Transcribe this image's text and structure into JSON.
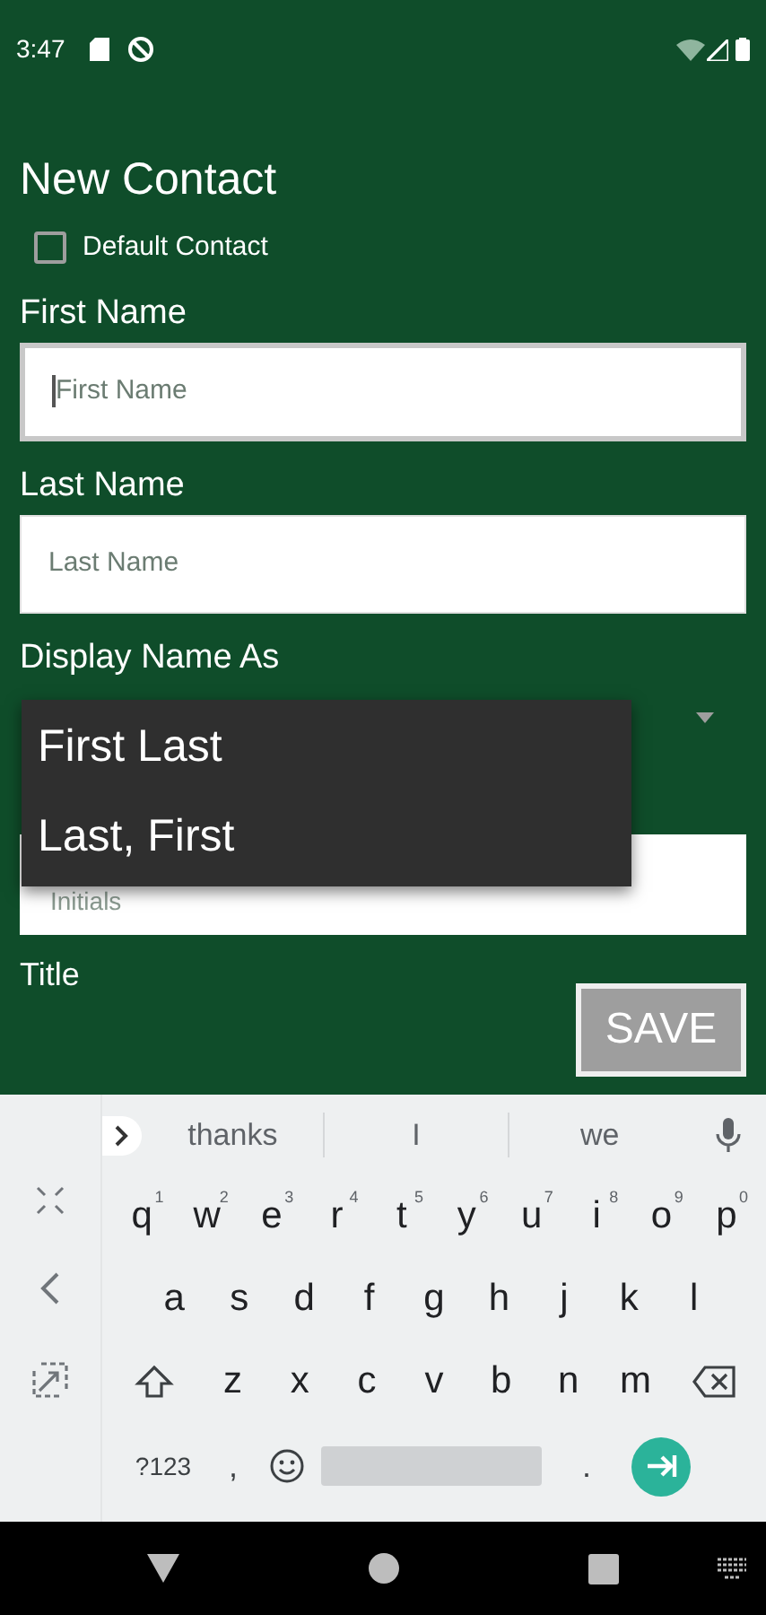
{
  "status_bar": {
    "time": "3:47"
  },
  "form": {
    "title": "New Contact",
    "default_contact": {
      "label": "Default Contact",
      "checked": false
    },
    "fields": [
      {
        "label": "First Name",
        "placeholder": "First Name",
        "focused": true
      },
      {
        "label": "Last Name",
        "placeholder": "Last Name",
        "focused": false
      }
    ],
    "display_name": {
      "label": "Display Name As",
      "options": [
        "First Last",
        "Last, First"
      ]
    },
    "initials": {
      "placeholder": "Initials"
    },
    "next_label": "Title",
    "save_button": "SAVE"
  },
  "keyboard": {
    "suggestions": [
      "thanks",
      "I",
      "we"
    ],
    "rows": [
      [
        {
          "key": "q",
          "hint": "1"
        },
        {
          "key": "w",
          "hint": "2"
        },
        {
          "key": "e",
          "hint": "3"
        },
        {
          "key": "r",
          "hint": "4"
        },
        {
          "key": "t",
          "hint": "5"
        },
        {
          "key": "y",
          "hint": "6"
        },
        {
          "key": "u",
          "hint": "7"
        },
        {
          "key": "i",
          "hint": "8"
        },
        {
          "key": "o",
          "hint": "9"
        },
        {
          "key": "p",
          "hint": "0"
        }
      ],
      [
        {
          "key": "a"
        },
        {
          "key": "s"
        },
        {
          "key": "d"
        },
        {
          "key": "f"
        },
        {
          "key": "g"
        },
        {
          "key": "h"
        },
        {
          "key": "j"
        },
        {
          "key": "k"
        },
        {
          "key": "l"
        }
      ],
      [
        {
          "key": "z"
        },
        {
          "key": "x"
        },
        {
          "key": "c"
        },
        {
          "key": "v"
        },
        {
          "key": "b"
        },
        {
          "key": "n"
        },
        {
          "key": "m"
        }
      ]
    ],
    "symbols_key": "?123",
    "comma_key": ",",
    "period_key": "."
  }
}
